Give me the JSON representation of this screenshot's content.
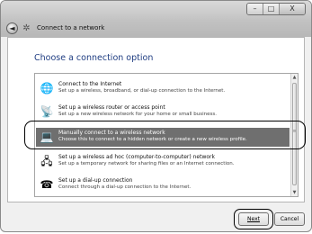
{
  "window": {
    "title": "Connect to a network",
    "controls": {
      "minimize": "–",
      "maximize": "□",
      "close": "X"
    },
    "back_glyph": "◄",
    "wizard_icon_glyph": "✲"
  },
  "page": {
    "heading": "Choose a connection option"
  },
  "options": [
    {
      "title": "Connect to the Internet",
      "desc": "Set up a wireless, broadband, or dial-up connection to the Internet.",
      "icon": "globe-icon",
      "glyph": "🌐"
    },
    {
      "title": "Set up a wireless router or access point",
      "desc": "Set up a new wireless network for your home or small business.",
      "icon": "router-icon",
      "glyph": "📡"
    },
    {
      "title": "Manually connect to a wireless network",
      "desc": "Choose this to connect to a hidden network or create a new wireless profile.",
      "icon": "computer-network-icon",
      "glyph": "💻",
      "selected": true
    },
    {
      "title": "Set up a wireless ad hoc (computer-to-computer) network",
      "desc": "Set up a temporary network for sharing files or an Internet connection.",
      "icon": "ad-hoc-network-icon",
      "glyph": "🖧"
    },
    {
      "title": "Set up a dial-up connection",
      "desc": "Connect through a dial-up connection to the Internet.",
      "icon": "dialup-phone-icon",
      "glyph": "☎"
    }
  ],
  "buttons": {
    "next": "Next",
    "cancel": "Cancel"
  }
}
